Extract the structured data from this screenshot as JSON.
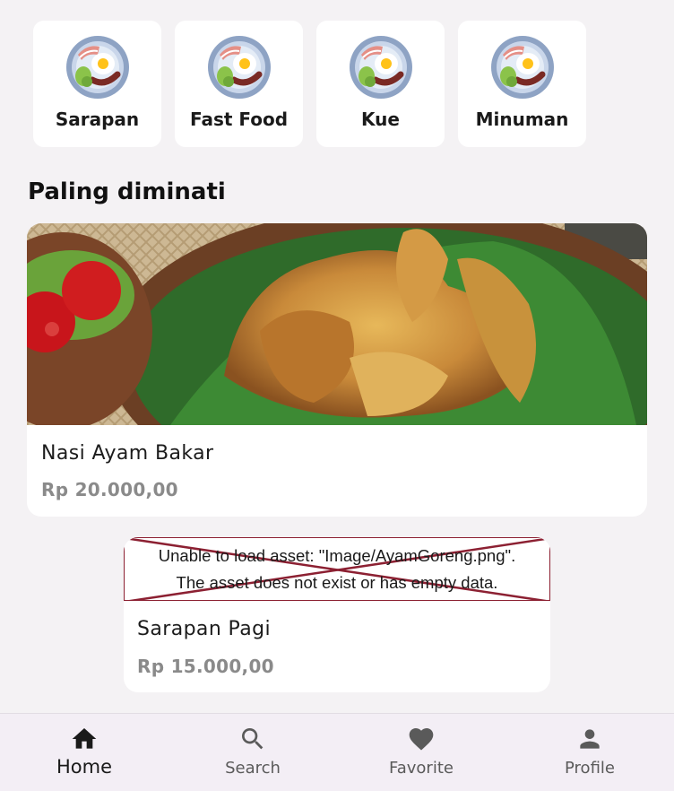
{
  "categories": [
    {
      "label": "Sarapan",
      "icon": "breakfast-plate-icon"
    },
    {
      "label": "Fast Food",
      "icon": "breakfast-plate-icon"
    },
    {
      "label": "Kue",
      "icon": "breakfast-plate-icon"
    },
    {
      "label": "Minuman",
      "icon": "breakfast-plate-icon"
    }
  ],
  "section": {
    "title": "Paling diminati"
  },
  "foods": [
    {
      "name": "Nasi Ayam Bakar",
      "price": "Rp 20.000,00",
      "image": "fried-chicken-photo"
    },
    {
      "name": "Sarapan Pagi",
      "price": "Rp 15.000,00",
      "image_error": {
        "line1": "Unable to load asset: \"Image/AyamGoreng.png\".",
        "line2": "The asset does not exist or has empty data."
      }
    }
  ],
  "nav": [
    {
      "label": "Home",
      "icon": "home-icon",
      "active": true
    },
    {
      "label": "Search",
      "icon": "search-icon",
      "active": false
    },
    {
      "label": "Favorite",
      "icon": "heart-icon",
      "active": false
    },
    {
      "label": "Profile",
      "icon": "person-icon",
      "active": false
    }
  ],
  "colors": {
    "background": "#f4f2f4",
    "card": "#ffffff",
    "nav_bg": "#f3eef5",
    "price": "#8a8a8a",
    "error_border": "#8c2032"
  }
}
